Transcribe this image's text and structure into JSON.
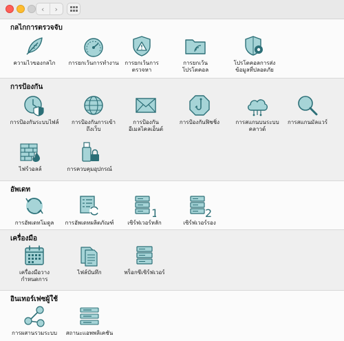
{
  "window": {
    "nav": {
      "back": "‹",
      "forward": "›"
    }
  },
  "sections": [
    {
      "title": "กลไกการตรวจจับ",
      "items": [
        {
          "label": "ความไวของกลไก",
          "icon": "feather-icon"
        },
        {
          "label": "การยกเว้นการทำงาน",
          "icon": "gauge-icon"
        },
        {
          "label": "การยกเว้นการ\nตรวจหา",
          "icon": "warning-shield-icon"
        },
        {
          "label": "การยกเว้น\nโปรโตคอล",
          "icon": "folder-wifi-icon"
        },
        {
          "label": "โปรโตคอลการส่ง\nข้อมูลที่ปลอดภัย",
          "icon": "shield-gear-icon"
        }
      ]
    },
    {
      "title": "การป้องกัน",
      "items": [
        {
          "label": "การป้องกันระบบไฟล์",
          "icon": "clock-shield-icon"
        },
        {
          "label": "การป้องกันการเข้า\nถึงเว็บ",
          "icon": "globe-icon"
        },
        {
          "label": "การป้องกัน\nอีเมลไคลเอ็นต์",
          "icon": "envelope-icon"
        },
        {
          "label": "การป้องกันฟิชชิ่ง",
          "icon": "hook-icon"
        },
        {
          "label": "การสแกนบนระบบ\nคลาวด์",
          "icon": "cloud-icon"
        },
        {
          "label": "การสแกนมัลแวร์",
          "icon": "magnifier-icon"
        },
        {
          "label": "ไฟร์วอลล์",
          "icon": "firewall-icon"
        },
        {
          "label": "การควบคุมอุปกรณ์",
          "icon": "usb-lock-icon"
        }
      ]
    },
    {
      "title": "อัพเดท",
      "items": [
        {
          "label": "การอัพเดทโมดูล",
          "icon": "refresh-icon"
        },
        {
          "label": "การอัพเดทผลิตภัณฑ์",
          "icon": "product-update-icon"
        },
        {
          "label": "เซิร์ฟเวอร์หลัก",
          "icon": "server-1-icon",
          "badge": "1"
        },
        {
          "label": "เซิร์ฟเวอร์รอง",
          "icon": "server-2-icon",
          "badge": "2"
        }
      ]
    },
    {
      "title": "เครื่องมือ",
      "items": [
        {
          "label": "เครื่องมือวาง\nกำหนดการ",
          "icon": "calendar-icon"
        },
        {
          "label": "ไฟล์บันทึก",
          "icon": "log-files-icon"
        },
        {
          "label": "พร็อกซีเซิร์ฟเวอร์",
          "icon": "proxy-server-icon"
        }
      ]
    },
    {
      "title": "อินเทอร์เฟซผู้ใช้",
      "items": [
        {
          "label": "การผสานรวมระบบ",
          "icon": "share-nodes-icon"
        },
        {
          "label": "สถานะแอพพลิเคชัน",
          "icon": "status-list-icon"
        }
      ]
    }
  ],
  "colors": {
    "icon_fill": "#a6d4d7",
    "icon_stroke": "#2c6f77"
  }
}
